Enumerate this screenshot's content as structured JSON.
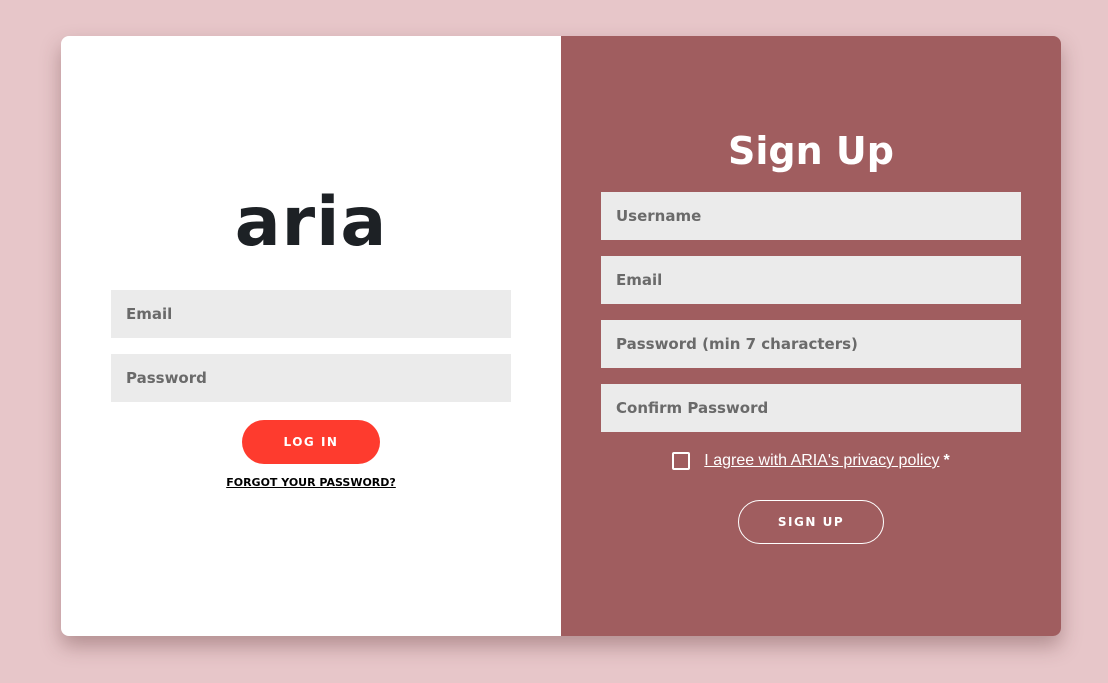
{
  "login": {
    "logo": "aria",
    "email_placeholder": "Email",
    "password_placeholder": "Password",
    "login_label": "LOG IN",
    "forgot_label": "FORGOT YOUR PASSWORD?"
  },
  "signup": {
    "title": "Sign Up",
    "username_placeholder": "Username",
    "email_placeholder": "Email",
    "password_placeholder": "Password (min 7 characters)",
    "confirm_placeholder": "Confirm Password",
    "agree_label": "I agree with ARIA's privacy policy",
    "required_mark": "*",
    "signup_label": "SIGN UP"
  },
  "colors": {
    "page_background": "#e7c6c9",
    "signup_panel": "#a05d5f",
    "login_button": "#fe3b2e",
    "input_background": "#ebebeb"
  }
}
